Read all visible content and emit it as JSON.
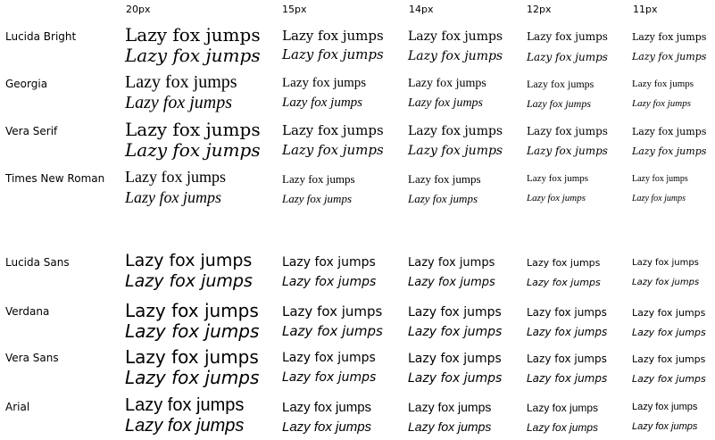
{
  "headers": [
    "20px",
    "15px",
    "14px",
    "12px",
    "11px"
  ],
  "sample_text": "Lazy fox jumps",
  "fonts": [
    {
      "name": "Lucida Bright"
    },
    {
      "name": "Georgia"
    },
    {
      "name": "Vera Serif"
    },
    {
      "name": "Times New Roman"
    },
    {
      "name": "Lucida Sans"
    },
    {
      "name": "Verdana"
    },
    {
      "name": "Vera Sans"
    },
    {
      "name": "Arial"
    }
  ]
}
